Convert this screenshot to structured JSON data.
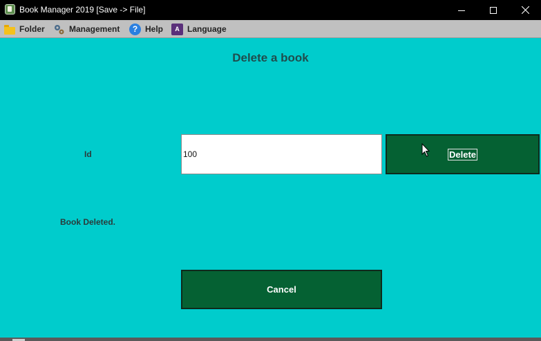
{
  "window": {
    "title": "Book Manager 2019 [Save -> File]"
  },
  "menu": [
    {
      "label": "Folder",
      "icon": "folder-icon"
    },
    {
      "label": "Management",
      "icon": "gears-icon"
    },
    {
      "label": "Help",
      "icon": "help-icon"
    },
    {
      "label": "Language",
      "icon": "language-icon"
    }
  ],
  "page": {
    "heading": "Delete a book",
    "id_label": "Id",
    "id_value": "100",
    "delete_label": "Delete",
    "status": "Book Deleted.",
    "cancel_label": "Cancel"
  },
  "colors": {
    "background": "#00cccc",
    "button": "#056133",
    "menubar": "#c0c0c0",
    "titlebar": "#000000"
  }
}
